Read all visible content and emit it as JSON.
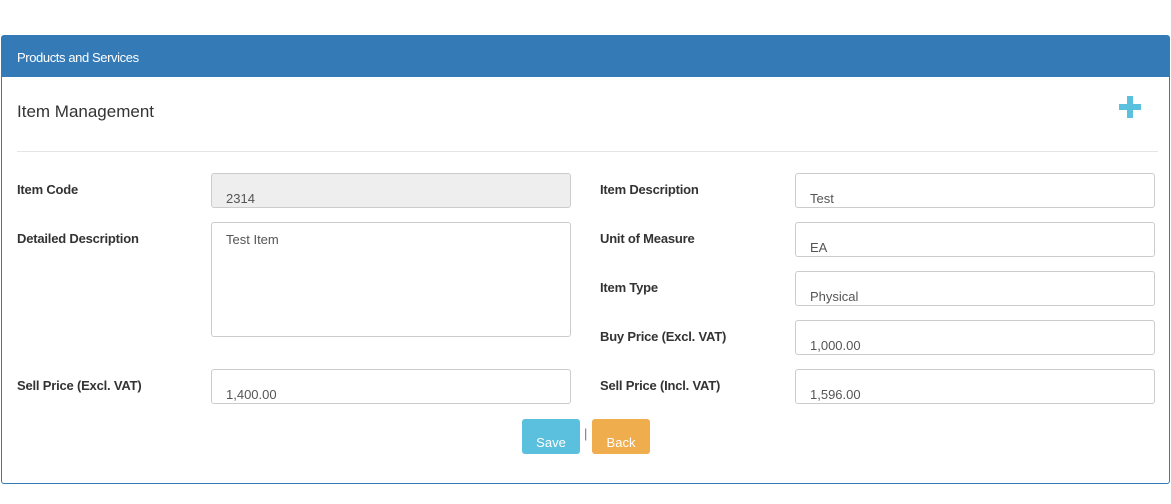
{
  "panel": {
    "heading": "Products and Services"
  },
  "page": {
    "title": "Item Management"
  },
  "icons": {
    "add": "plus-icon",
    "add_color": "#5bc0de"
  },
  "colors": {
    "primary": "#337ab7",
    "info": "#5bc0de",
    "warning": "#f0ad4e"
  },
  "form": {
    "item_code": {
      "label": "Item Code",
      "value": "2314"
    },
    "item_description": {
      "label": "Item Description",
      "value": "Test"
    },
    "detailed_description": {
      "label": "Detailed Description",
      "value": "Test Item"
    },
    "unit_of_measure": {
      "label": "Unit of Measure",
      "value": "EA"
    },
    "item_type": {
      "label": "Item Type",
      "value": "Physical"
    },
    "buy_price_excl": {
      "label": "Buy Price (Excl. VAT)",
      "value": "1,000.00"
    },
    "sell_price_excl": {
      "label": "Sell Price (Excl. VAT)",
      "value": "1,400.00"
    },
    "sell_price_incl": {
      "label": "Sell Price (Incl. VAT)",
      "value": "1,596.00"
    }
  },
  "actions": {
    "save": "Save",
    "separator": "|",
    "back": "Back"
  }
}
